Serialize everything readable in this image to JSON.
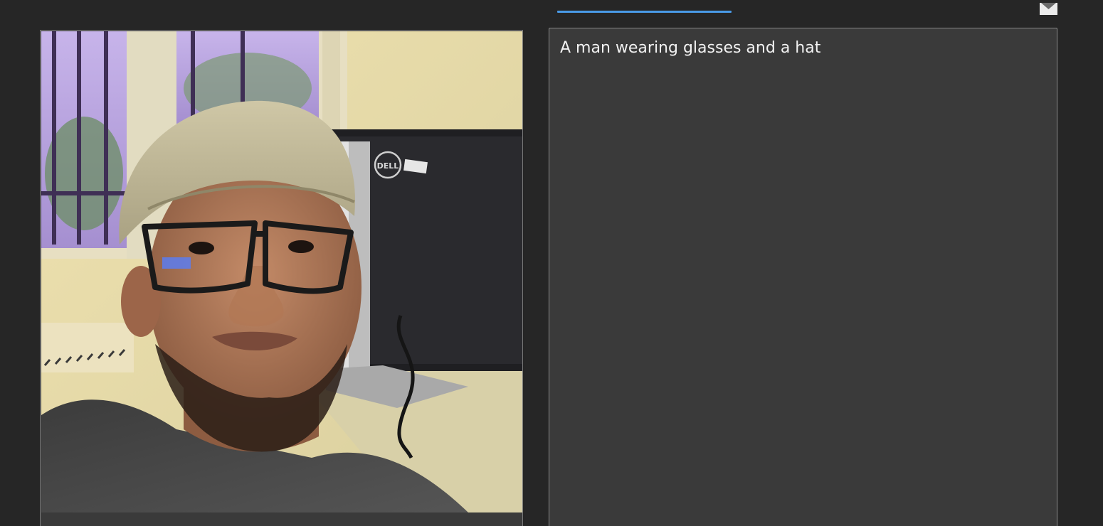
{
  "tabs": {
    "active_indicator_color": "#4a9be8"
  },
  "top_menu": {
    "icon": "chevron-down-icon"
  },
  "image_panel": {
    "photo_subject": "selfie-photo",
    "monitor_brand": "DELL"
  },
  "caption_panel": {
    "caption": "A man wearing glasses and a hat"
  },
  "colors": {
    "background": "#262626",
    "panel": "#3a3a3a",
    "accent": "#4a9be8",
    "text": "#f2f2f2"
  }
}
